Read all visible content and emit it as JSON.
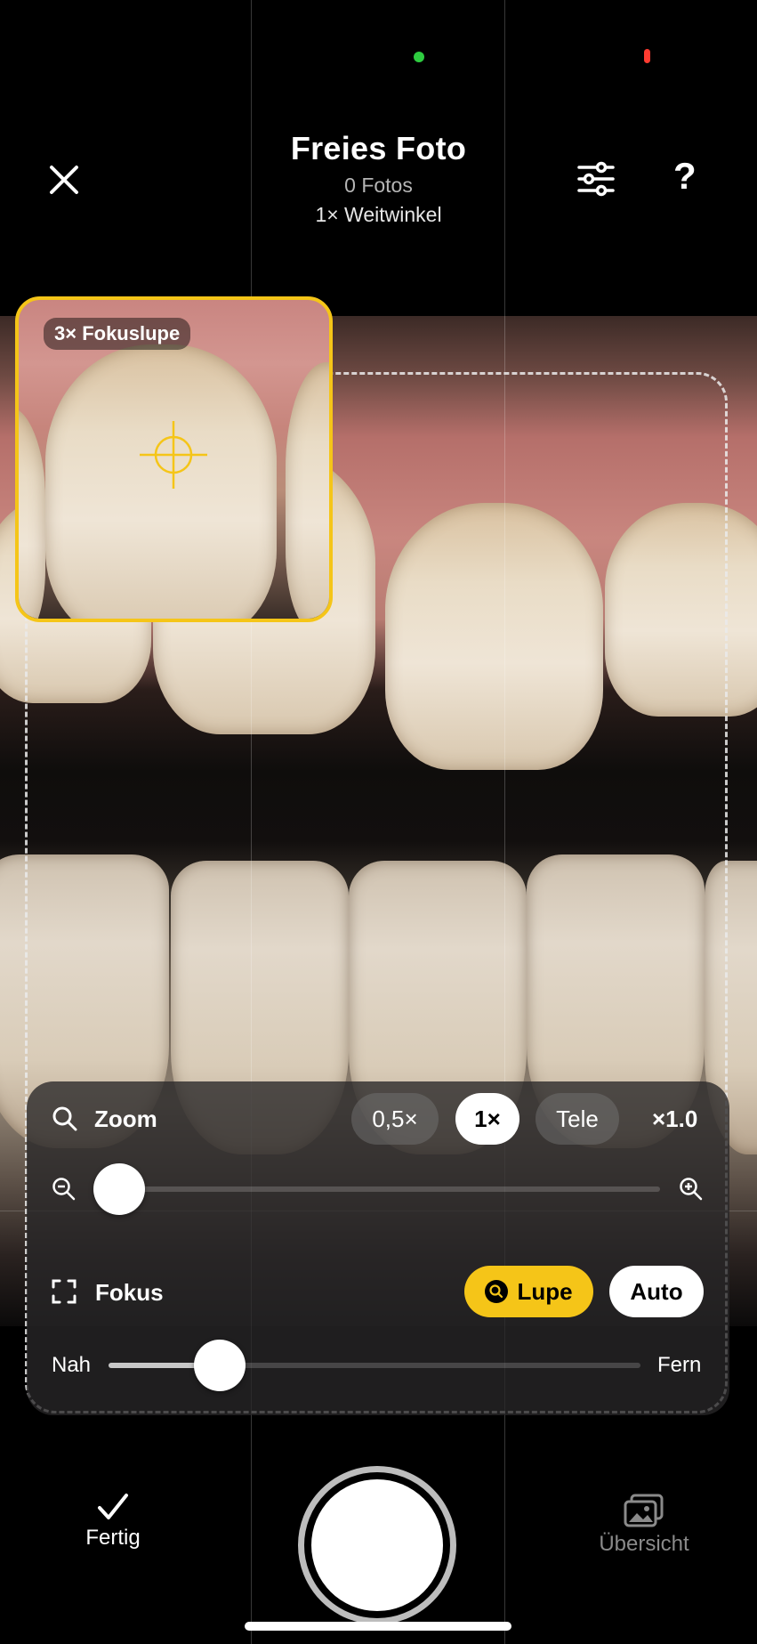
{
  "status": {
    "camera_dot_color": "#2ecc40",
    "mic_dot_color": "#ff3b30"
  },
  "header": {
    "title": "Freies Foto",
    "photo_count": "0 Fotos",
    "lens": "1× Weitwinkel",
    "close_icon": "close-icon",
    "settings_icon": "sliders-icon",
    "help_label": "?"
  },
  "loupe": {
    "label": "3× Fokuslupe",
    "accent": "#f5c518"
  },
  "zoom": {
    "label": "Zoom",
    "options": [
      "0,5×",
      "1×",
      "Tele"
    ],
    "selected": "1×",
    "factor": "×1.0",
    "slider_level": 0.02
  },
  "focus": {
    "label": "Fokus",
    "lupe_label": "Lupe",
    "auto_label": "Auto",
    "near_label": "Nah",
    "far_label": "Fern",
    "slider_level": 0.2
  },
  "bottom": {
    "done_label": "Fertig",
    "overview_label": "Übersicht"
  }
}
